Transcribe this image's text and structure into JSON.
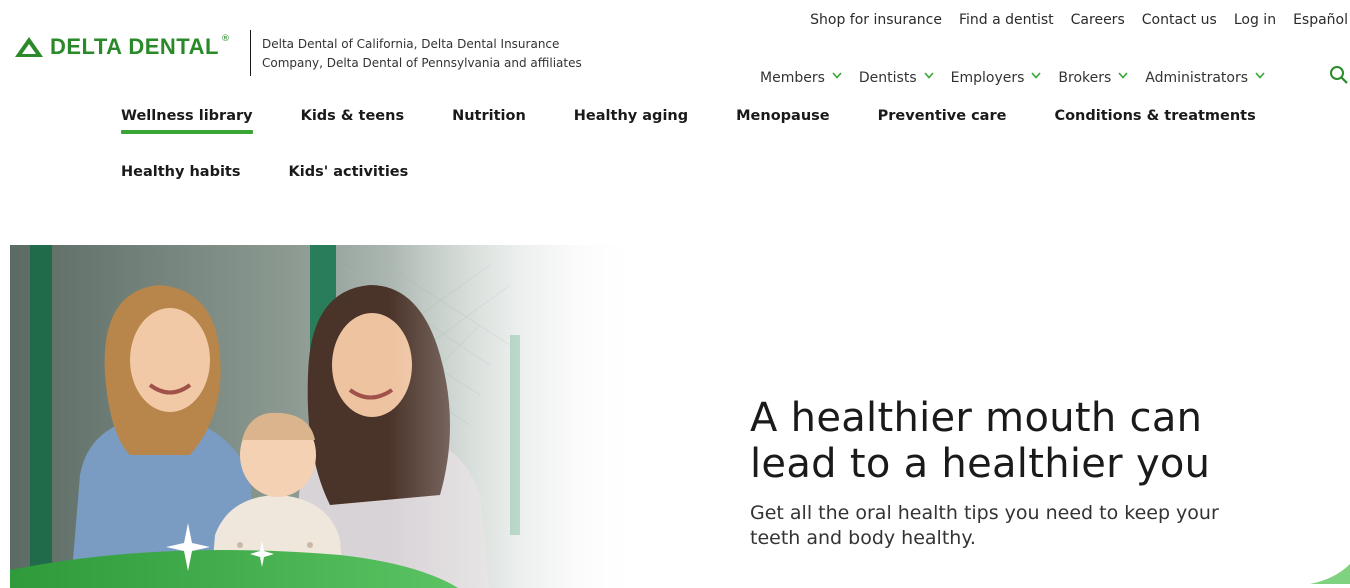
{
  "brand": {
    "name": "DELTA DENTAL",
    "registered_mark": "®",
    "affiliates": "Delta Dental of California, Delta Dental Insurance Company, Delta Dental of Pennsylvania and affiliates",
    "color": "#2a8a2a"
  },
  "utility_nav": [
    {
      "label": "Shop for insurance"
    },
    {
      "label": "Find a dentist"
    },
    {
      "label": "Careers"
    },
    {
      "label": "Contact us"
    },
    {
      "label": "Log in"
    },
    {
      "label": "Español"
    }
  ],
  "main_nav": [
    {
      "label": "Members"
    },
    {
      "label": "Dentists"
    },
    {
      "label": "Employers"
    },
    {
      "label": "Brokers"
    },
    {
      "label": "Administrators"
    }
  ],
  "sub_nav": {
    "row1": [
      {
        "label": "Wellness library",
        "active": true
      },
      {
        "label": "Kids & teens"
      },
      {
        "label": "Nutrition"
      },
      {
        "label": "Healthy aging"
      },
      {
        "label": "Menopause"
      },
      {
        "label": "Preventive care"
      },
      {
        "label": "Conditions & treatments"
      }
    ],
    "row2": [
      {
        "label": "Healthy habits"
      },
      {
        "label": "Kids' activities"
      }
    ]
  },
  "hero": {
    "title_line1": "A healthier mouth can",
    "title_line2": "lead to a healthier you",
    "subtitle_line1": "Get all the oral health tips you need to keep your",
    "subtitle_line2": "teeth and body healthy."
  },
  "colors": {
    "accent": "#3aa535",
    "chevron": "#3aa535",
    "text": "#1a1a1a"
  },
  "icons": {
    "logo": "delta-triangle-icon",
    "chevron": "chevron-down-icon",
    "search": "search-icon"
  }
}
